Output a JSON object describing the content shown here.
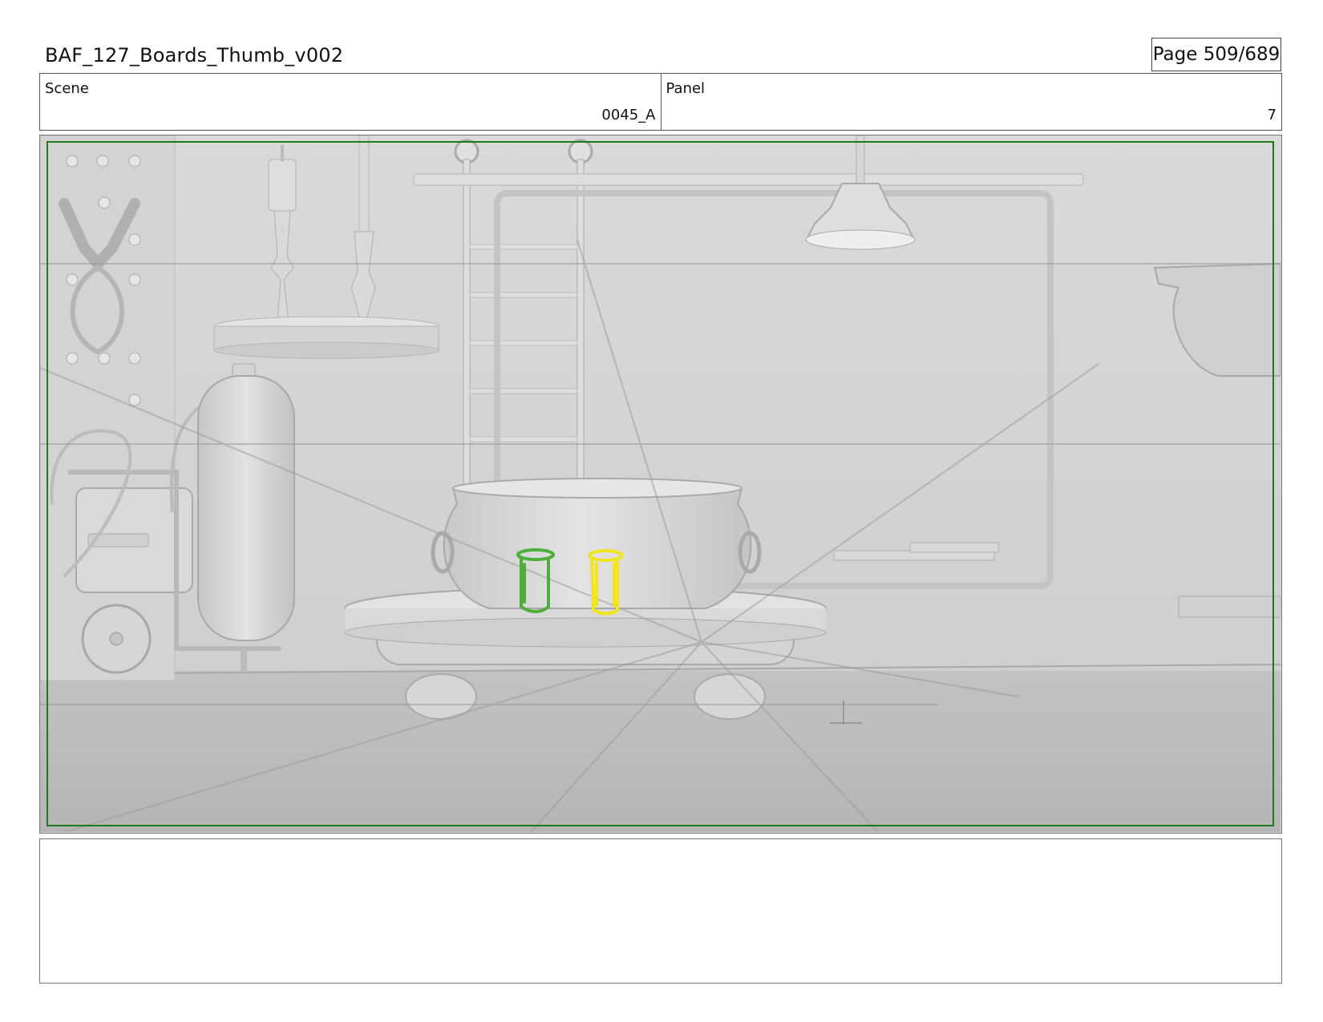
{
  "header": {
    "title": "BAF_127_Boards_Thumb_v002",
    "page": "Page 509/689"
  },
  "info": {
    "scene_label": "Scene",
    "scene_value": "0045_A",
    "panel_label": "Panel",
    "panel_value": "7"
  },
  "panel_image": {
    "description_icon": "storyboard-frame-image",
    "colors": {
      "safe_frame": "#1f7a1f",
      "green_sketch": "#4caf3a",
      "yellow_sketch": "#f2e51a"
    }
  },
  "notes": {
    "text": ""
  }
}
